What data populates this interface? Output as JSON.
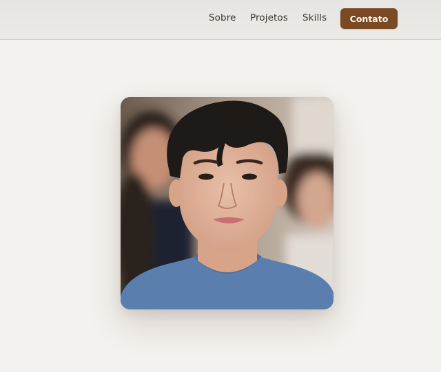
{
  "nav": {
    "links": [
      "Sobre",
      "Projetos",
      "Skills"
    ],
    "cta_label": "Contato"
  },
  "hero": {
    "photo_alt": "profile-photo"
  },
  "colors": {
    "accent": "#7a4a25",
    "background": "#f4f2ee",
    "header": "#e8e6e2"
  }
}
